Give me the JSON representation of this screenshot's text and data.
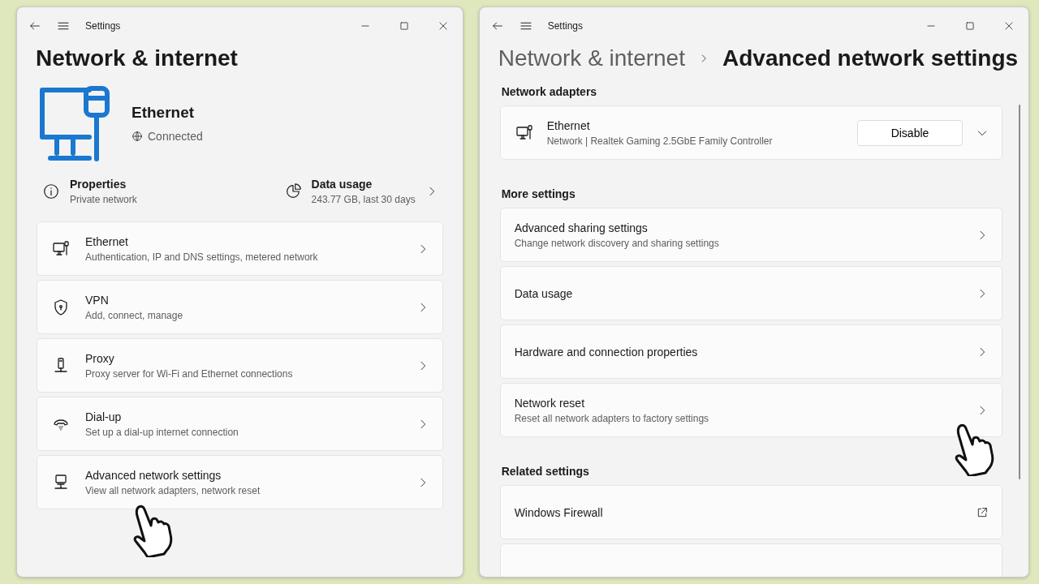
{
  "left_window": {
    "title": "Settings",
    "heading": "Network & internet",
    "connection": {
      "name": "Ethernet",
      "status": "Connected"
    },
    "properties": {
      "title": "Properties",
      "subtitle": "Private network"
    },
    "data_usage": {
      "title": "Data usage",
      "subtitle": "243.77 GB, last 30 days"
    },
    "items": [
      {
        "title": "Ethernet",
        "subtitle": "Authentication, IP and DNS settings, metered network"
      },
      {
        "title": "VPN",
        "subtitle": "Add, connect, manage"
      },
      {
        "title": "Proxy",
        "subtitle": "Proxy server for Wi-Fi and Ethernet connections"
      },
      {
        "title": "Dial-up",
        "subtitle": "Set up a dial-up internet connection"
      },
      {
        "title": "Advanced network settings",
        "subtitle": "View all network adapters, network reset"
      }
    ]
  },
  "right_window": {
    "title": "Settings",
    "breadcrumb": [
      "Network & internet",
      "Advanced network settings"
    ],
    "sections": [
      {
        "heading": "Network adapters",
        "items": [
          {
            "kind": "adapter",
            "title": "Ethernet",
            "subtitle": "Network | Realtek Gaming 2.5GbE Family Controller",
            "button": "Disable"
          }
        ]
      },
      {
        "heading": "More settings",
        "items": [
          {
            "kind": "link",
            "title": "Advanced sharing settings",
            "subtitle": "Change network discovery and sharing settings"
          },
          {
            "kind": "link",
            "title": "Data usage"
          },
          {
            "kind": "link",
            "title": "Hardware and connection properties"
          },
          {
            "kind": "link",
            "title": "Network reset",
            "subtitle": "Reset all network adapters to factory settings"
          }
        ]
      },
      {
        "heading": "Related settings",
        "items": [
          {
            "kind": "external",
            "title": "Windows Firewall"
          }
        ]
      }
    ]
  }
}
